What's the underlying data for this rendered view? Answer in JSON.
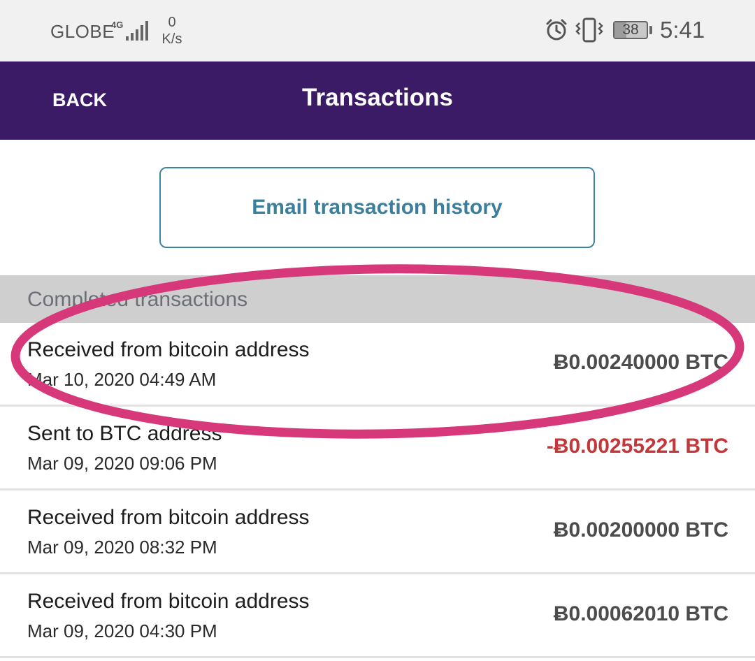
{
  "status_bar": {
    "carrier": "GLOBE",
    "network_type": "4G",
    "speed_value": "0",
    "speed_unit": "K/s",
    "battery_level": "38",
    "time": "5:41",
    "icons": [
      "signal-icon",
      "alarm-icon",
      "vibrate-icon",
      "battery-icon"
    ]
  },
  "header": {
    "back_label": "BACK",
    "title": "Transactions"
  },
  "email_button": {
    "label": "Email transaction history"
  },
  "section": {
    "label": "Completed transactions"
  },
  "transactions": [
    {
      "title": "Received from bitcoin address",
      "date": "Mar 10, 2020 04:49 AM",
      "amount": "Ƀ0.00240000 BTC",
      "negative": false
    },
    {
      "title": "Sent to BTC address",
      "date": "Mar 09, 2020 09:06 PM",
      "amount": "-Ƀ0.00255221 BTC",
      "negative": true
    },
    {
      "title": "Received from bitcoin address",
      "date": "Mar 09, 2020 08:32 PM",
      "amount": "Ƀ0.00200000 BTC",
      "negative": false
    },
    {
      "title": "Received from bitcoin address",
      "date": "Mar 09, 2020 04:30 PM",
      "amount": "Ƀ0.00062010 BTC",
      "negative": false
    }
  ],
  "colors": {
    "header_bg": "#3b1b66",
    "button_border": "#3b84a2",
    "button_text": "#3b7f9c",
    "negative_amount": "#c2383a",
    "annotation": "#d6387a"
  }
}
